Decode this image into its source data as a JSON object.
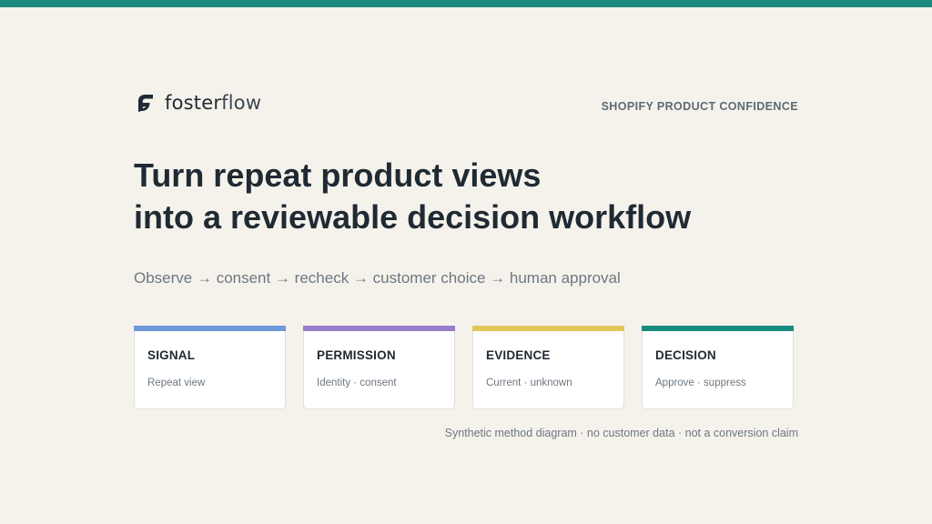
{
  "brand": {
    "name_bold": "foster",
    "name_light": "flow",
    "logo_icon": "fosterflow-logo-icon",
    "logo_color": "#1f2a33"
  },
  "eyebrow": "SHOPIFY PRODUCT CONFIDENCE",
  "headline": {
    "line1": "Turn repeat product views",
    "line2": "into a reviewable decision workflow"
  },
  "subline": "Observe → consent → recheck → customer choice → human approval",
  "cards": [
    {
      "title": "SIGNAL",
      "desc": "Repeat view",
      "accent": "#6f98d8"
    },
    {
      "title": "PERMISSION",
      "desc": "Identity · consent",
      "accent": "#9a7ccc"
    },
    {
      "title": "EVIDENCE",
      "desc": "Current · unknown",
      "accent": "#e2c65a"
    },
    {
      "title": "DECISION",
      "desc": "Approve · suppress",
      "accent": "#1a8a7e"
    }
  ],
  "footnote": "Synthetic method diagram · no customer data · not a conversion claim",
  "colors": {
    "top_bar": "#1a8a7e",
    "background": "#f5f2ec"
  }
}
